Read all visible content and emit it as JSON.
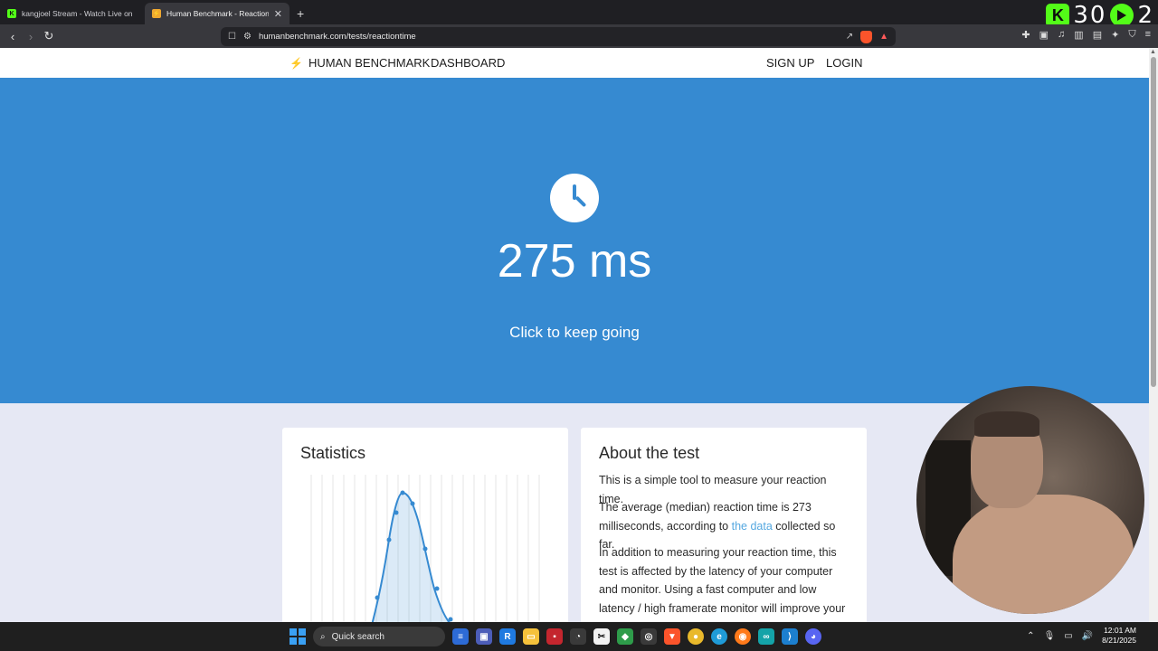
{
  "browser": {
    "tabs": [
      {
        "title": "kangjoel Stream - Watch Live on",
        "favicon": "kick-icon",
        "active": false
      },
      {
        "title": "Human Benchmark - Reaction Ti",
        "favicon": "bolt-icon",
        "active": true
      }
    ],
    "url": "humanbenchmark.com/tests/reactiontime"
  },
  "overlay": {
    "count_left": "30",
    "count_right": "2"
  },
  "site_nav": {
    "brand": "HUMAN BENCHMARK",
    "dashboard": "DASHBOARD",
    "signup": "SIGN UP",
    "login": "LOGIN"
  },
  "hero": {
    "result": "275 ms",
    "prompt": "Click to keep going",
    "background": "#368ad1"
  },
  "statistics": {
    "title": "Statistics"
  },
  "about": {
    "title": "About the test",
    "p1": "This is a simple tool to measure your reaction time.",
    "p2_before": "The average (median) reaction time is 273 milliseconds, according to ",
    "p2_link": "the data",
    "p2_after": " collected so far.",
    "p3": "In addition to measuring your reaction time, this test is affected by the latency of your computer and monitor. Using a fast computer and low latency / high framerate monitor will improve your score."
  },
  "taskbar": {
    "search_placeholder": "Quick search",
    "time": "12:01 AM",
    "date": "8/21/2025"
  }
}
